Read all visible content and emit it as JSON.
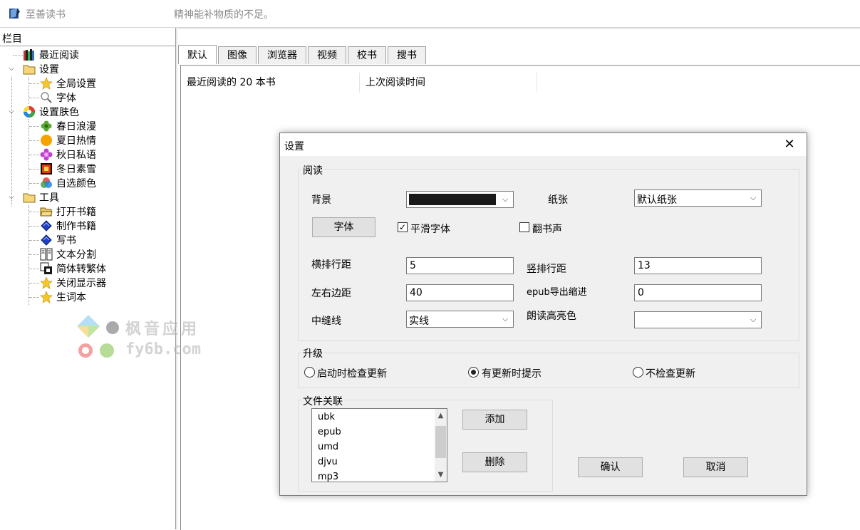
{
  "app": {
    "title": "至善读书",
    "quote": "精神能补物质的不足。"
  },
  "left_panel": {
    "header": "栏目",
    "tree": [
      {
        "label": "最近阅读",
        "icon": "books-icon"
      },
      {
        "label": "设置",
        "icon": "folder-icon"
      },
      {
        "label": "全局设置",
        "icon": "star-icon"
      },
      {
        "label": "字体",
        "icon": "magnifier-icon"
      },
      {
        "label": "设置肤色",
        "icon": "color-wheel-icon"
      },
      {
        "label": "春日浪漫",
        "icon": "green-flower-icon"
      },
      {
        "label": "夏日热情",
        "icon": "orange-circle-icon"
      },
      {
        "label": "秋日私语",
        "icon": "purple-flower-icon"
      },
      {
        "label": "冬日素雪",
        "icon": "fire-square-icon"
      },
      {
        "label": "自选颜色",
        "icon": "rgb-palette-icon"
      },
      {
        "label": "工具",
        "icon": "folder-icon"
      },
      {
        "label": "打开书籍",
        "icon": "open-folder-icon"
      },
      {
        "label": "制作书籍",
        "icon": "blue-book-icon"
      },
      {
        "label": "写书",
        "icon": "blue-book-icon"
      },
      {
        "label": "文本分割",
        "icon": "split-text-icon"
      },
      {
        "label": "简体转繁体",
        "icon": "convert-icon"
      },
      {
        "label": "关闭显示器",
        "icon": "star-icon"
      },
      {
        "label": "生词本",
        "icon": "star-icon"
      }
    ]
  },
  "tabs": [
    "默认",
    "图像",
    "浏览器",
    "视频",
    "校书",
    "搜书"
  ],
  "recent_list": {
    "columns": [
      "最近阅读的 20 本书",
      "上次阅读时间"
    ]
  },
  "watermark": {
    "line1": "枫音应用",
    "line2": "fy6b.com"
  },
  "dialog": {
    "title": "设置",
    "close": "✕",
    "reading": {
      "group_label": "阅读",
      "background_label": "背景",
      "paper_label": "纸张",
      "paper_value": "默认纸张",
      "font_button": "字体",
      "smooth_font_label": "平滑字体",
      "smooth_font_checked": true,
      "page_sound_label": "翻书声",
      "page_sound_checked": false,
      "h_spacing_label": "横排行距",
      "h_spacing_value": "5",
      "v_spacing_label": "竖排行距",
      "v_spacing_value": "13",
      "margin_label": "左右边距",
      "margin_value": "40",
      "epub_indent_label": "epub导出缩进",
      "epub_indent_value": "0",
      "gutter_label": "中缝线",
      "gutter_value": "实线",
      "highlight_label": "朗读高亮色",
      "highlight_value": ""
    },
    "upgrade": {
      "group_label": "升级",
      "options": [
        "启动时检查更新",
        "有更新时提示",
        "不检查更新"
      ],
      "selected": 1
    },
    "file_assoc": {
      "group_label": "文件关联",
      "items": [
        "ubk",
        "epub",
        "umd",
        "djvu",
        "mp3"
      ],
      "add_button": "添加",
      "delete_button": "删除"
    },
    "ok_button": "确认",
    "cancel_button": "取消"
  }
}
